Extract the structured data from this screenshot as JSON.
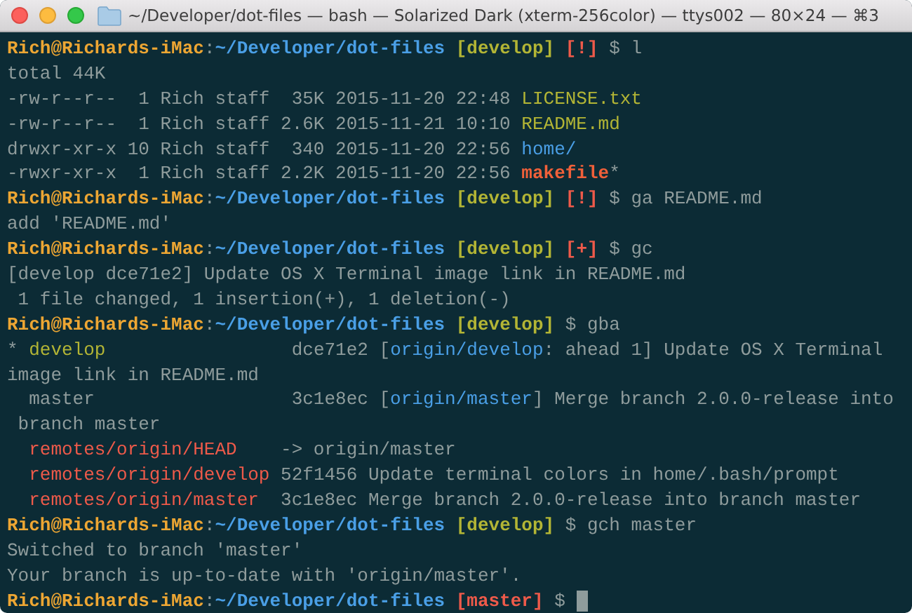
{
  "window": {
    "title": "~/Developer/dot-files — bash — Solarized Dark (xterm-256color) — ttys002 — 80×24 — ⌘3"
  },
  "lines": [
    {
      "segments": [
        {
          "text": "Rich@Richards-iMac",
          "kind": "user"
        },
        {
          "text": ":",
          "kind": "plain"
        },
        {
          "text": "~/Developer/dot-files",
          "kind": "path"
        },
        {
          "text": " [develop]",
          "kind": "branch"
        },
        {
          "text": " [!]",
          "kind": "flag"
        },
        {
          "text": " $ l",
          "kind": "plain"
        }
      ]
    },
    {
      "segments": [
        {
          "text": "total 44K",
          "kind": "plain"
        }
      ]
    },
    {
      "segments": [
        {
          "text": "-rw-r--r--  1 Rich staff  35K 2015-11-20 22:48 ",
          "kind": "plain"
        },
        {
          "text": "LICENSE.txt",
          "kind": "file"
        }
      ]
    },
    {
      "segments": [
        {
          "text": "-rw-r--r--  1 Rich staff 2.6K 2015-11-21 10:10 ",
          "kind": "plain"
        },
        {
          "text": "README.md",
          "kind": "file"
        }
      ]
    },
    {
      "segments": [
        {
          "text": "drwxr-xr-x 10 Rich staff  340 2015-11-20 22:56 ",
          "kind": "plain"
        },
        {
          "text": "home/",
          "kind": "dir"
        }
      ]
    },
    {
      "segments": [
        {
          "text": "-rwxr-xr-x  1 Rich staff 2.2K 2015-11-20 22:56 ",
          "kind": "plain"
        },
        {
          "text": "makefile",
          "kind": "exec"
        },
        {
          "text": "*",
          "kind": "plain"
        }
      ]
    },
    {
      "segments": [
        {
          "text": "Rich@Richards-iMac",
          "kind": "user"
        },
        {
          "text": ":",
          "kind": "plain"
        },
        {
          "text": "~/Developer/dot-files",
          "kind": "path"
        },
        {
          "text": " [develop]",
          "kind": "branch"
        },
        {
          "text": " [!]",
          "kind": "flag"
        },
        {
          "text": " $ ga README.md",
          "kind": "plain"
        }
      ]
    },
    {
      "segments": [
        {
          "text": "add 'README.md'",
          "kind": "plain"
        }
      ]
    },
    {
      "segments": [
        {
          "text": "Rich@Richards-iMac",
          "kind": "user"
        },
        {
          "text": ":",
          "kind": "plain"
        },
        {
          "text": "~/Developer/dot-files",
          "kind": "path"
        },
        {
          "text": " [develop]",
          "kind": "branch"
        },
        {
          "text": " [+]",
          "kind": "flag"
        },
        {
          "text": " $ gc",
          "kind": "plain"
        }
      ]
    },
    {
      "segments": [
        {
          "text": "[develop dce71e2] Update OS X Terminal image link in README.md",
          "kind": "plain"
        }
      ]
    },
    {
      "segments": [
        {
          "text": " 1 file changed, 1 insertion(+), 1 deletion(-)",
          "kind": "plain"
        }
      ]
    },
    {
      "segments": [
        {
          "text": "Rich@Richards-iMac",
          "kind": "user"
        },
        {
          "text": ":",
          "kind": "plain"
        },
        {
          "text": "~/Developer/dot-files",
          "kind": "path"
        },
        {
          "text": " [develop]",
          "kind": "branch"
        },
        {
          "text": " $ gba",
          "kind": "plain"
        }
      ]
    },
    {
      "segments": [
        {
          "text": "* ",
          "kind": "plain"
        },
        {
          "text": "develop",
          "kind": "current"
        },
        {
          "text": "                 dce71e2 [",
          "kind": "plain"
        },
        {
          "text": "origin/develop",
          "kind": "tracking"
        },
        {
          "text": ": ahead 1] Update OS X Terminal",
          "kind": "plain"
        }
      ]
    },
    {
      "segments": [
        {
          "text": "image link in README.md",
          "kind": "plain"
        }
      ]
    },
    {
      "segments": [
        {
          "text": "  master                  3c1e8ec [",
          "kind": "plain"
        },
        {
          "text": "origin/master",
          "kind": "tracking"
        },
        {
          "text": "] Merge branch 2.0.0-release into",
          "kind": "plain"
        }
      ]
    },
    {
      "segments": [
        {
          "text": " branch master",
          "kind": "plain"
        }
      ]
    },
    {
      "segments": [
        {
          "text": "  remotes/origin/HEAD",
          "kind": "remote"
        },
        {
          "text": "    -> origin/master",
          "kind": "plain"
        }
      ]
    },
    {
      "segments": [
        {
          "text": "  remotes/origin/develop",
          "kind": "remote"
        },
        {
          "text": " 52f1456 Update terminal colors in home/.bash/prompt",
          "kind": "plain"
        }
      ]
    },
    {
      "segments": [
        {
          "text": "  remotes/origin/master",
          "kind": "remote"
        },
        {
          "text": "  3c1e8ec Merge branch 2.0.0-release into branch master",
          "kind": "plain"
        }
      ]
    },
    {
      "segments": [
        {
          "text": "Rich@Richards-iMac",
          "kind": "user"
        },
        {
          "text": ":",
          "kind": "plain"
        },
        {
          "text": "~/Developer/dot-files",
          "kind": "path"
        },
        {
          "text": " [develop]",
          "kind": "branch"
        },
        {
          "text": " $ gch master",
          "kind": "plain"
        }
      ]
    },
    {
      "segments": [
        {
          "text": "Switched to branch 'master'",
          "kind": "plain"
        }
      ]
    },
    {
      "segments": [
        {
          "text": "Your branch is up-to-date with 'origin/master'.",
          "kind": "plain"
        }
      ]
    },
    {
      "cursor": true,
      "segments": [
        {
          "text": "Rich@Richards-iMac",
          "kind": "user"
        },
        {
          "text": ":",
          "kind": "plain"
        },
        {
          "text": "~/Developer/dot-files",
          "kind": "path"
        },
        {
          "text": " [master]",
          "kind": "flag"
        },
        {
          "text": " $ ",
          "kind": "plain"
        }
      ]
    }
  ]
}
